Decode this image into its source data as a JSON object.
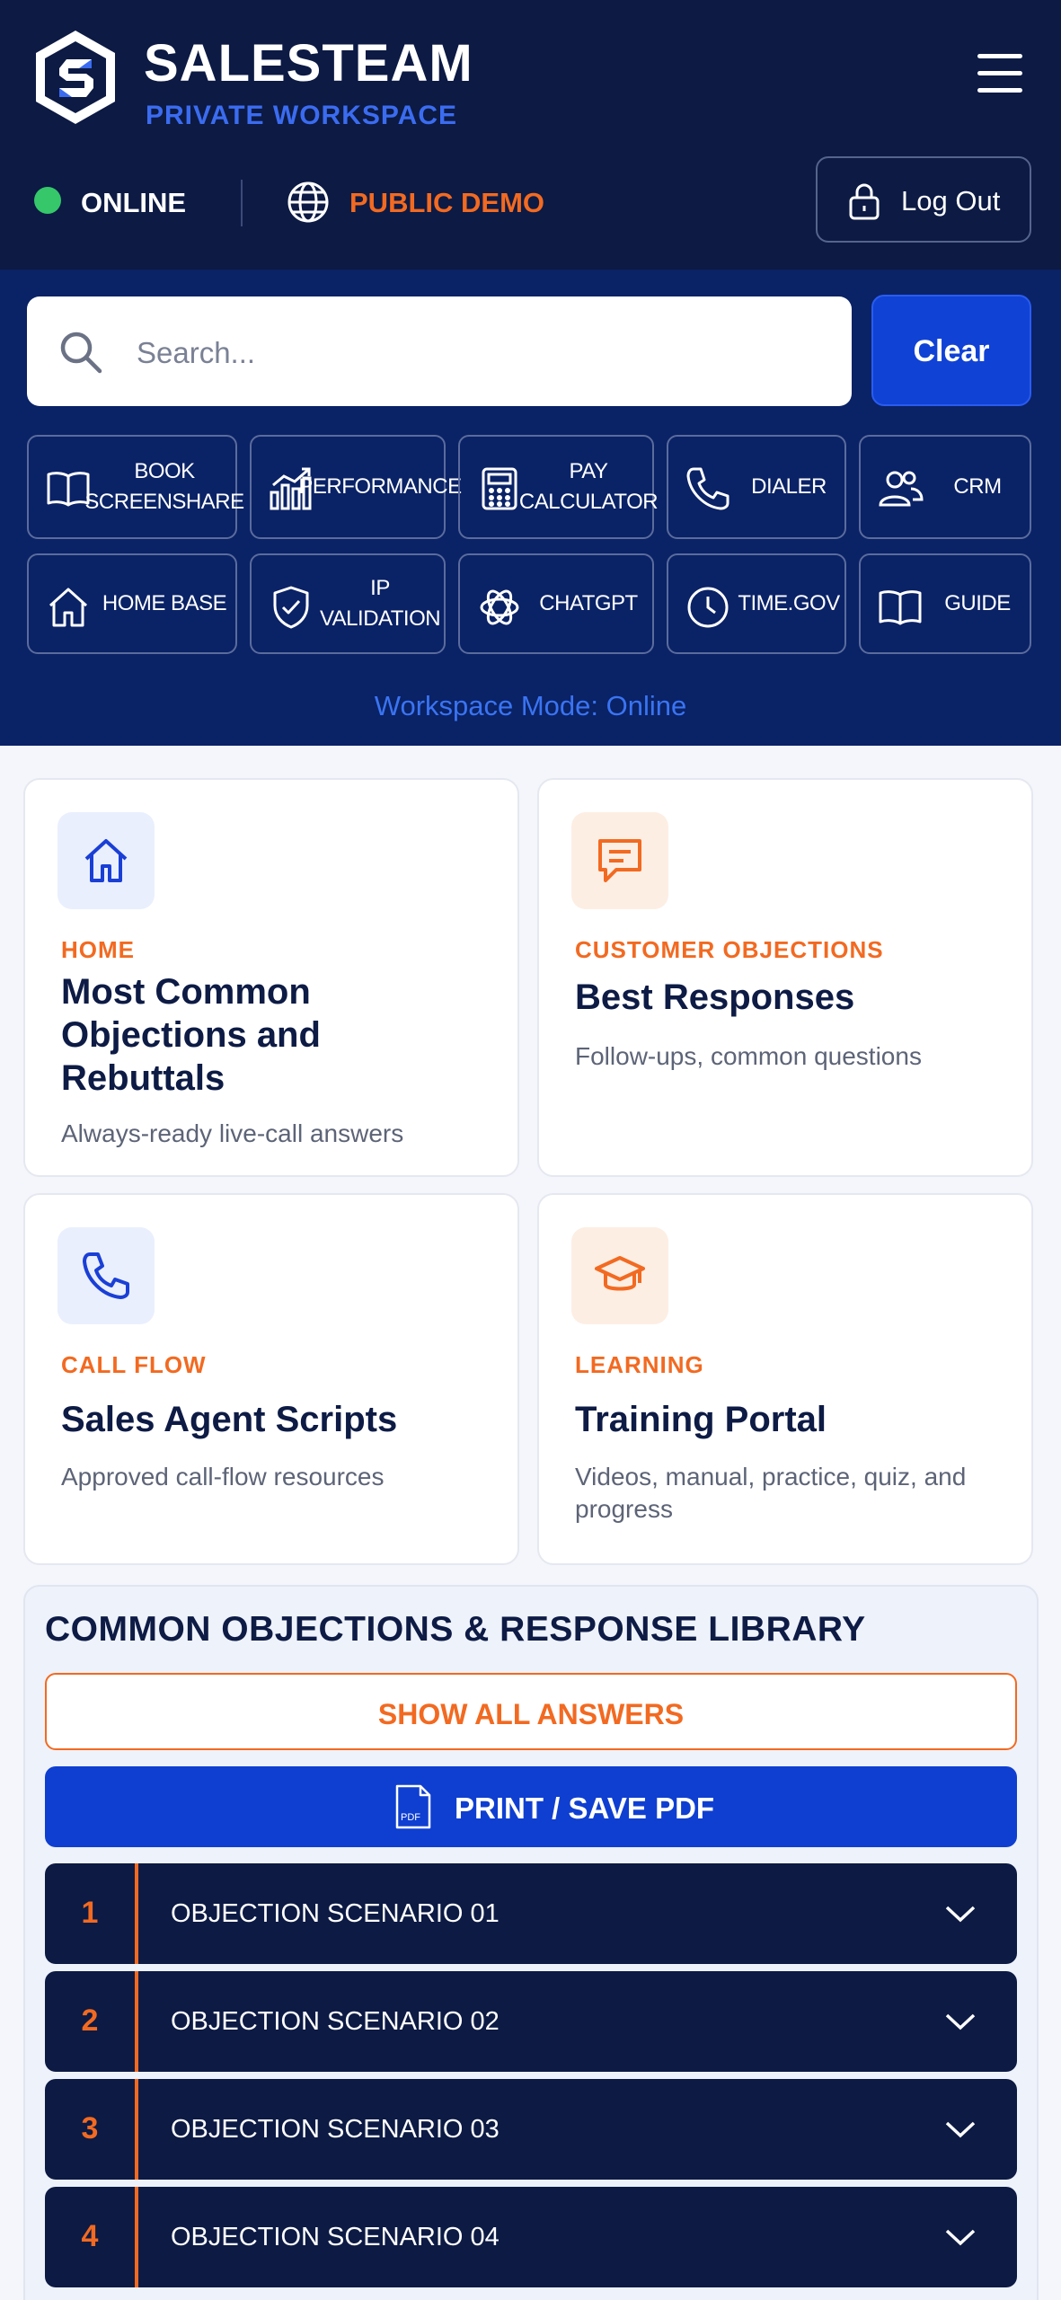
{
  "header": {
    "brand": "SALESTEAM",
    "subtitle": "PRIVATE WORKSPACE",
    "status": "ONLINE",
    "mode_badge": "PUBLIC DEMO",
    "logout_label": "Log Out"
  },
  "toolbar": {
    "search_placeholder": "Search...",
    "clear_label": "Clear",
    "quick_links": [
      {
        "label": "BOOK SCREENSHARE",
        "icon": "book-icon"
      },
      {
        "label": "PERFORMANCE",
        "icon": "bar-chart-icon"
      },
      {
        "label": "PAY CALCULATOR",
        "icon": "calculator-icon"
      },
      {
        "label": "DIALER",
        "icon": "phone-icon"
      },
      {
        "label": "CRM",
        "icon": "users-icon"
      },
      {
        "label": "HOME BASE",
        "icon": "home-icon"
      },
      {
        "label": "IP VALIDATION",
        "icon": "shield-check-icon"
      },
      {
        "label": "CHATGPT",
        "icon": "chatgpt-icon"
      },
      {
        "label": "TIME.GOV",
        "icon": "clock-icon"
      },
      {
        "label": "GUIDE",
        "icon": "book-icon"
      }
    ],
    "workspace_mode": "Workspace Mode: Online"
  },
  "cards": [
    {
      "category": "HOME",
      "title": "Most Common Objections and Rebuttals",
      "description": "Always-ready live-call answers",
      "icon": "home-icon"
    },
    {
      "category": "CUSTOMER OBJECTIONS",
      "title": "Best Responses",
      "description": "Follow-ups, common questions",
      "icon": "message-icon"
    },
    {
      "category": "CALL FLOW",
      "title": "Sales Agent Scripts",
      "description": "Approved call-flow resources",
      "icon": "phone-icon"
    },
    {
      "category": "LEARNING",
      "title": "Training Portal",
      "description": "Videos, manual, practice, quiz, and progress",
      "icon": "graduation-cap-icon"
    }
  ],
  "library": {
    "title": "COMMON OBJECTIONS & RESPONSE LIBRARY",
    "show_all": "SHOW ALL ANSWERS",
    "print": "PRINT / SAVE PDF",
    "scenarios": [
      {
        "num": "1",
        "label": "OBJECTION SCENARIO 01"
      },
      {
        "num": "2",
        "label": "OBJECTION SCENARIO 02"
      },
      {
        "num": "3",
        "label": "OBJECTION SCENARIO 03"
      },
      {
        "num": "4",
        "label": "OBJECTION SCENARIO 04"
      }
    ]
  },
  "colors": {
    "navy": "#0c1a44",
    "royal": "#0a2266",
    "accent_blue": "#1042d6",
    "accent_orange": "#f26a21",
    "online_green": "#35c76a"
  }
}
